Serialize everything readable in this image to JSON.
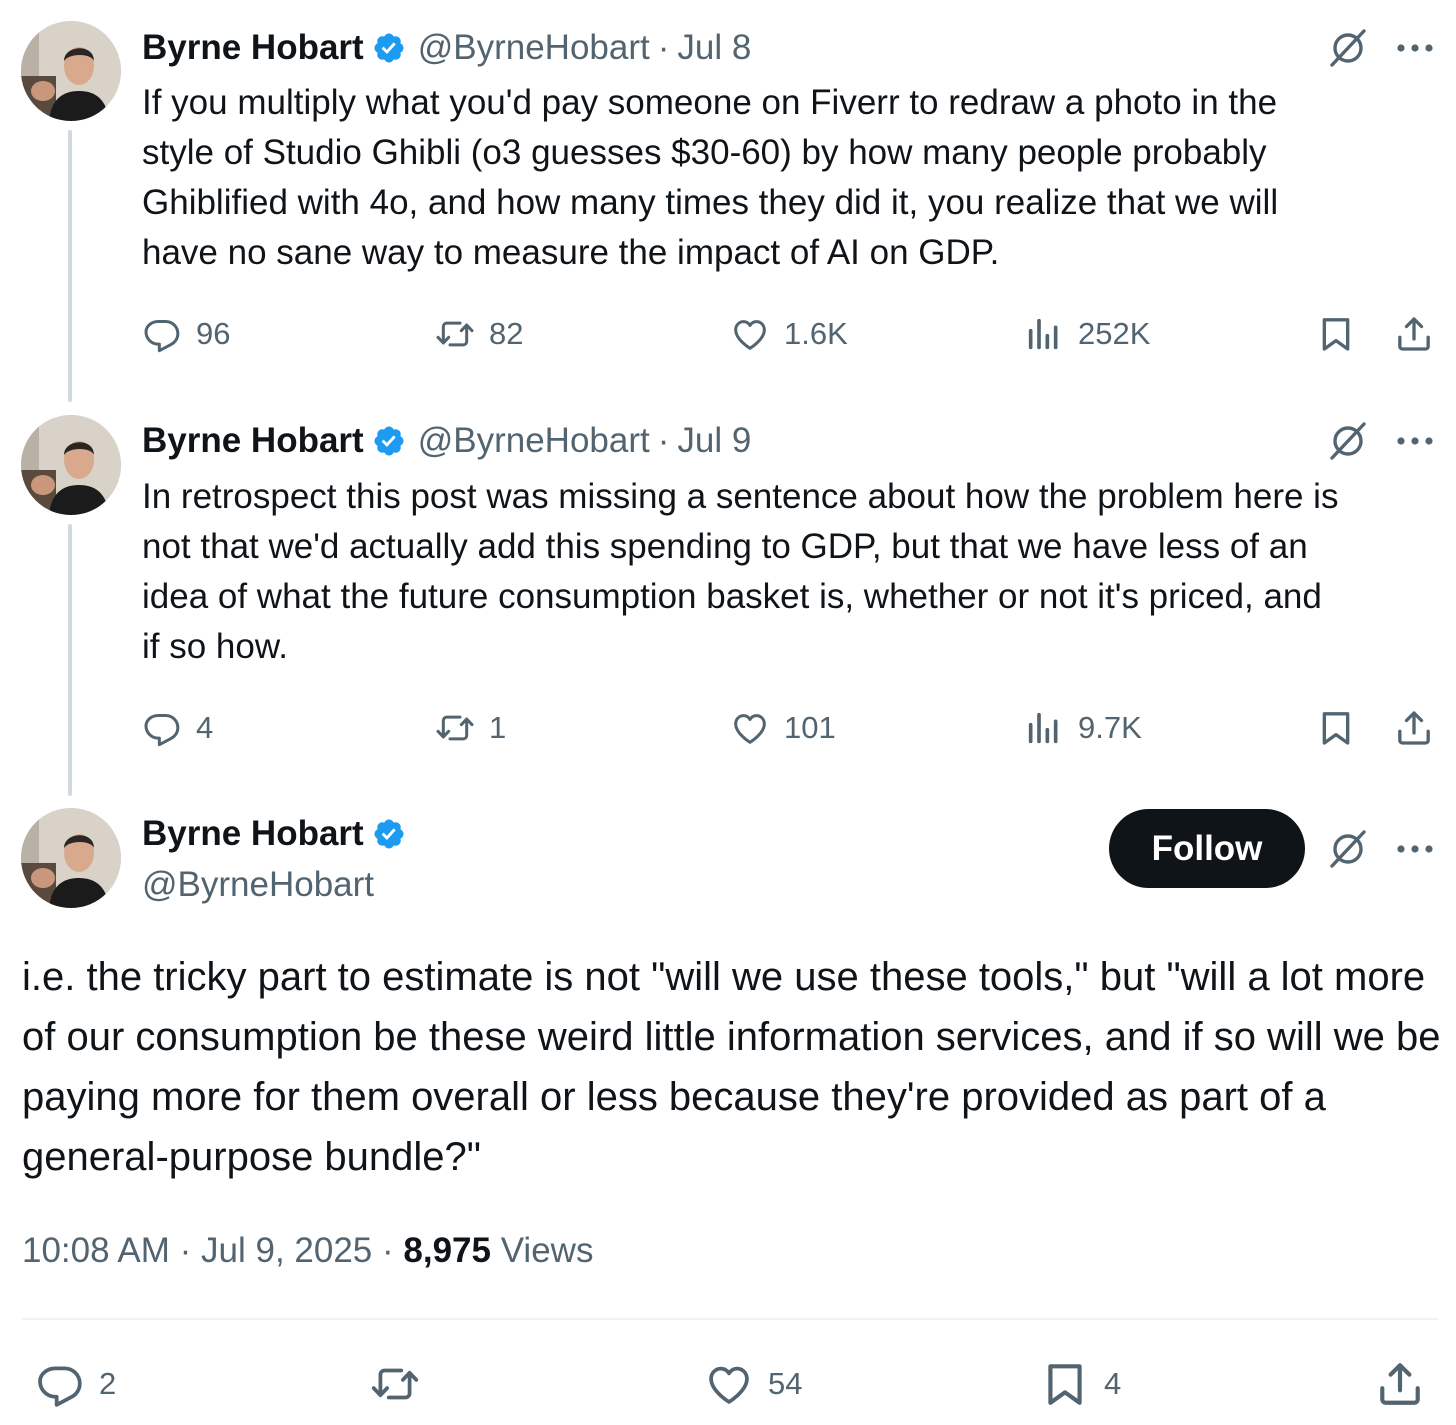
{
  "colors": {
    "text": "#0f1419",
    "secondary": "#536471",
    "verified": "#1d9bf0",
    "thread_line": "#cfd9de",
    "follow_bg": "#0f1419"
  },
  "icons": {
    "verified": "verified-badge-icon",
    "grok": "grok-icon",
    "more": "more-icon",
    "reply": "reply-icon",
    "repost": "repost-icon",
    "like": "like-icon",
    "views": "views-icon",
    "bookmark": "bookmark-icon",
    "share": "share-icon"
  },
  "tweets": [
    {
      "author": "Byrne Hobart",
      "handle": "@ByrneHobart",
      "separator": "·",
      "date": "Jul 8",
      "text": "If you multiply what you'd pay someone on Fiverr to redraw a photo in the\nstyle of Studio Ghibli (o3 guesses $30-60) by how many people probably\nGhiblified with 4o, and how many times they did it, you realize that we will\nhave no sane way to measure the impact of AI on GDP.",
      "replies": "96",
      "reposts": "82",
      "likes": "1.6K",
      "views": "252K"
    },
    {
      "author": "Byrne Hobart",
      "handle": "@ByrneHobart",
      "separator": "·",
      "date": "Jul 9",
      "text": "In retrospect this post was missing a sentence about how the problem here is\nnot that we'd actually add this spending to GDP, but that we have less of an\nidea of what the future consumption basket is, whether or not it's priced, and\nif so how.",
      "replies": "4",
      "reposts": "1",
      "likes": "101",
      "views": "9.7K"
    }
  ],
  "main": {
    "author": "Byrne Hobart",
    "handle": "@ByrneHobart",
    "follow_label": "Follow",
    "text": "i.e. the tricky part to estimate is not \"will we use these tools,\" but \"will a lot more of our consumption be these weird little information services, and if so will we be paying more for them overall or less because they're provided as part of a general-purpose bundle?\"",
    "time": "10:08 AM",
    "separator": "·",
    "date": "Jul 9, 2025",
    "views_count": "8,975",
    "views_label": "Views",
    "replies": "2",
    "likes": "54",
    "bookmarks": "4"
  }
}
